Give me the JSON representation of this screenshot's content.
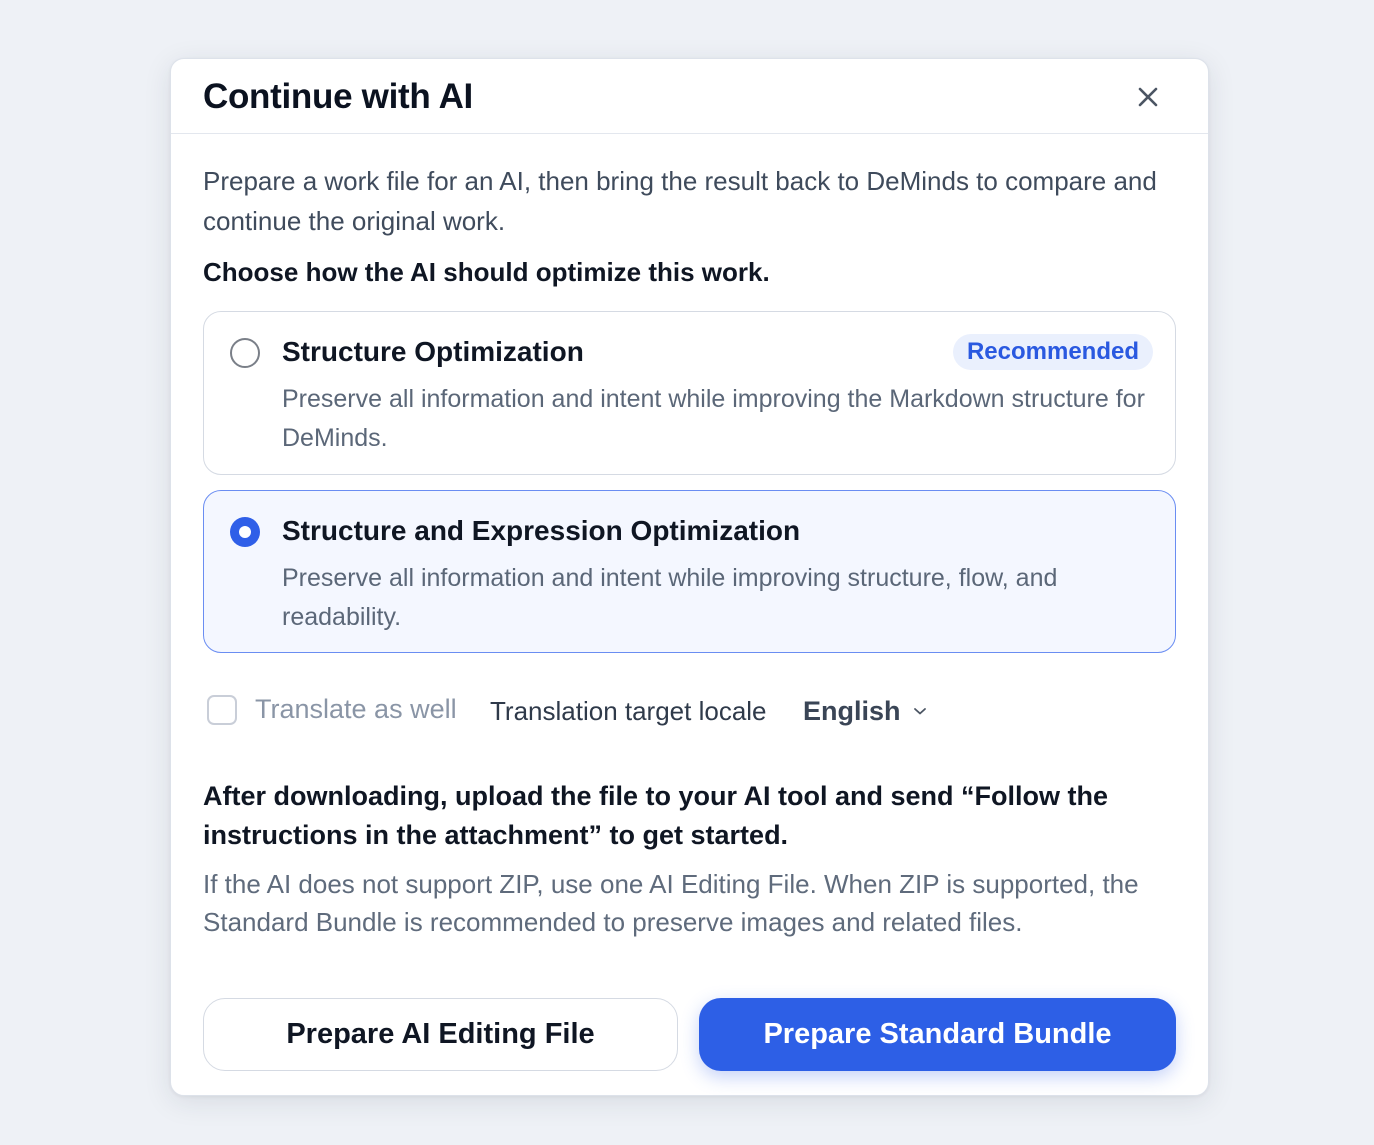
{
  "dialog": {
    "title": "Continue with AI",
    "intro": "Prepare a work file for an AI, then bring the result back to DeMinds to compare and continue the original work.",
    "prompt": "Choose how the AI should optimize this work.",
    "options": [
      {
        "title": "Structure Optimization",
        "badge": "Recommended",
        "description": "Preserve all information and intent while improving the Markdown structure for DeMinds.",
        "selected": false
      },
      {
        "title": "Structure and Expression Optimization",
        "description": "Preserve all information and intent while improving structure, flow, and readability.",
        "selected": true
      }
    ],
    "translate": {
      "checkbox_label": "Translate as well",
      "checked": false,
      "locale_label": "Translation target locale",
      "locale_value": "English"
    },
    "after_download": "After downloading, upload the file to your AI tool and send “Follow the instructions in the attachment” to get started.",
    "note": "If the AI does not support ZIP, use one AI Editing File. When ZIP is supported, the Standard Bundle is recommended to preserve images and related files.",
    "buttons": {
      "secondary": "Prepare AI Editing File",
      "primary": "Prepare Standard Bundle"
    }
  },
  "colors": {
    "accent": "#2d5fe6",
    "badge_bg": "#eaf0fd",
    "background": "#eef1f6"
  },
  "icons": {
    "close": "close-icon",
    "dropdown": "chevron-down-icon"
  }
}
